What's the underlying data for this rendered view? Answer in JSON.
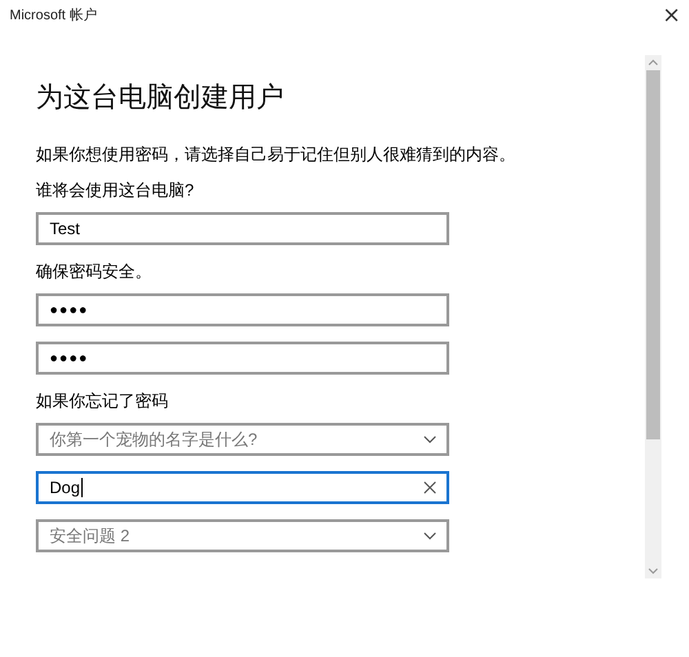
{
  "window": {
    "title": "Microsoft 帐户",
    "close": "×"
  },
  "heading": "为这台电脑创建用户",
  "intro": "如果你想使用密码，请选择自己易于记住但别人很难猜到的内容。",
  "rows": [
    {
      "kind": "label",
      "text": "谁将会使用这台电脑?"
    },
    {
      "kind": "text",
      "value": "Test",
      "focused": false
    },
    {
      "kind": "label",
      "text": "确保密码安全。"
    },
    {
      "kind": "password",
      "value": "●●●●",
      "focused": false
    },
    {
      "kind": "password",
      "value": "●●●●",
      "focused": false
    },
    {
      "kind": "label",
      "text": "如果你忘记了密码"
    },
    {
      "kind": "dropdown",
      "value": "你第一个宠物的名字是什么?",
      "focused": false
    },
    {
      "kind": "text",
      "value": "Dog",
      "focused": true
    },
    {
      "kind": "dropdown",
      "value": "安全问题 2",
      "focused": false
    }
  ]
}
